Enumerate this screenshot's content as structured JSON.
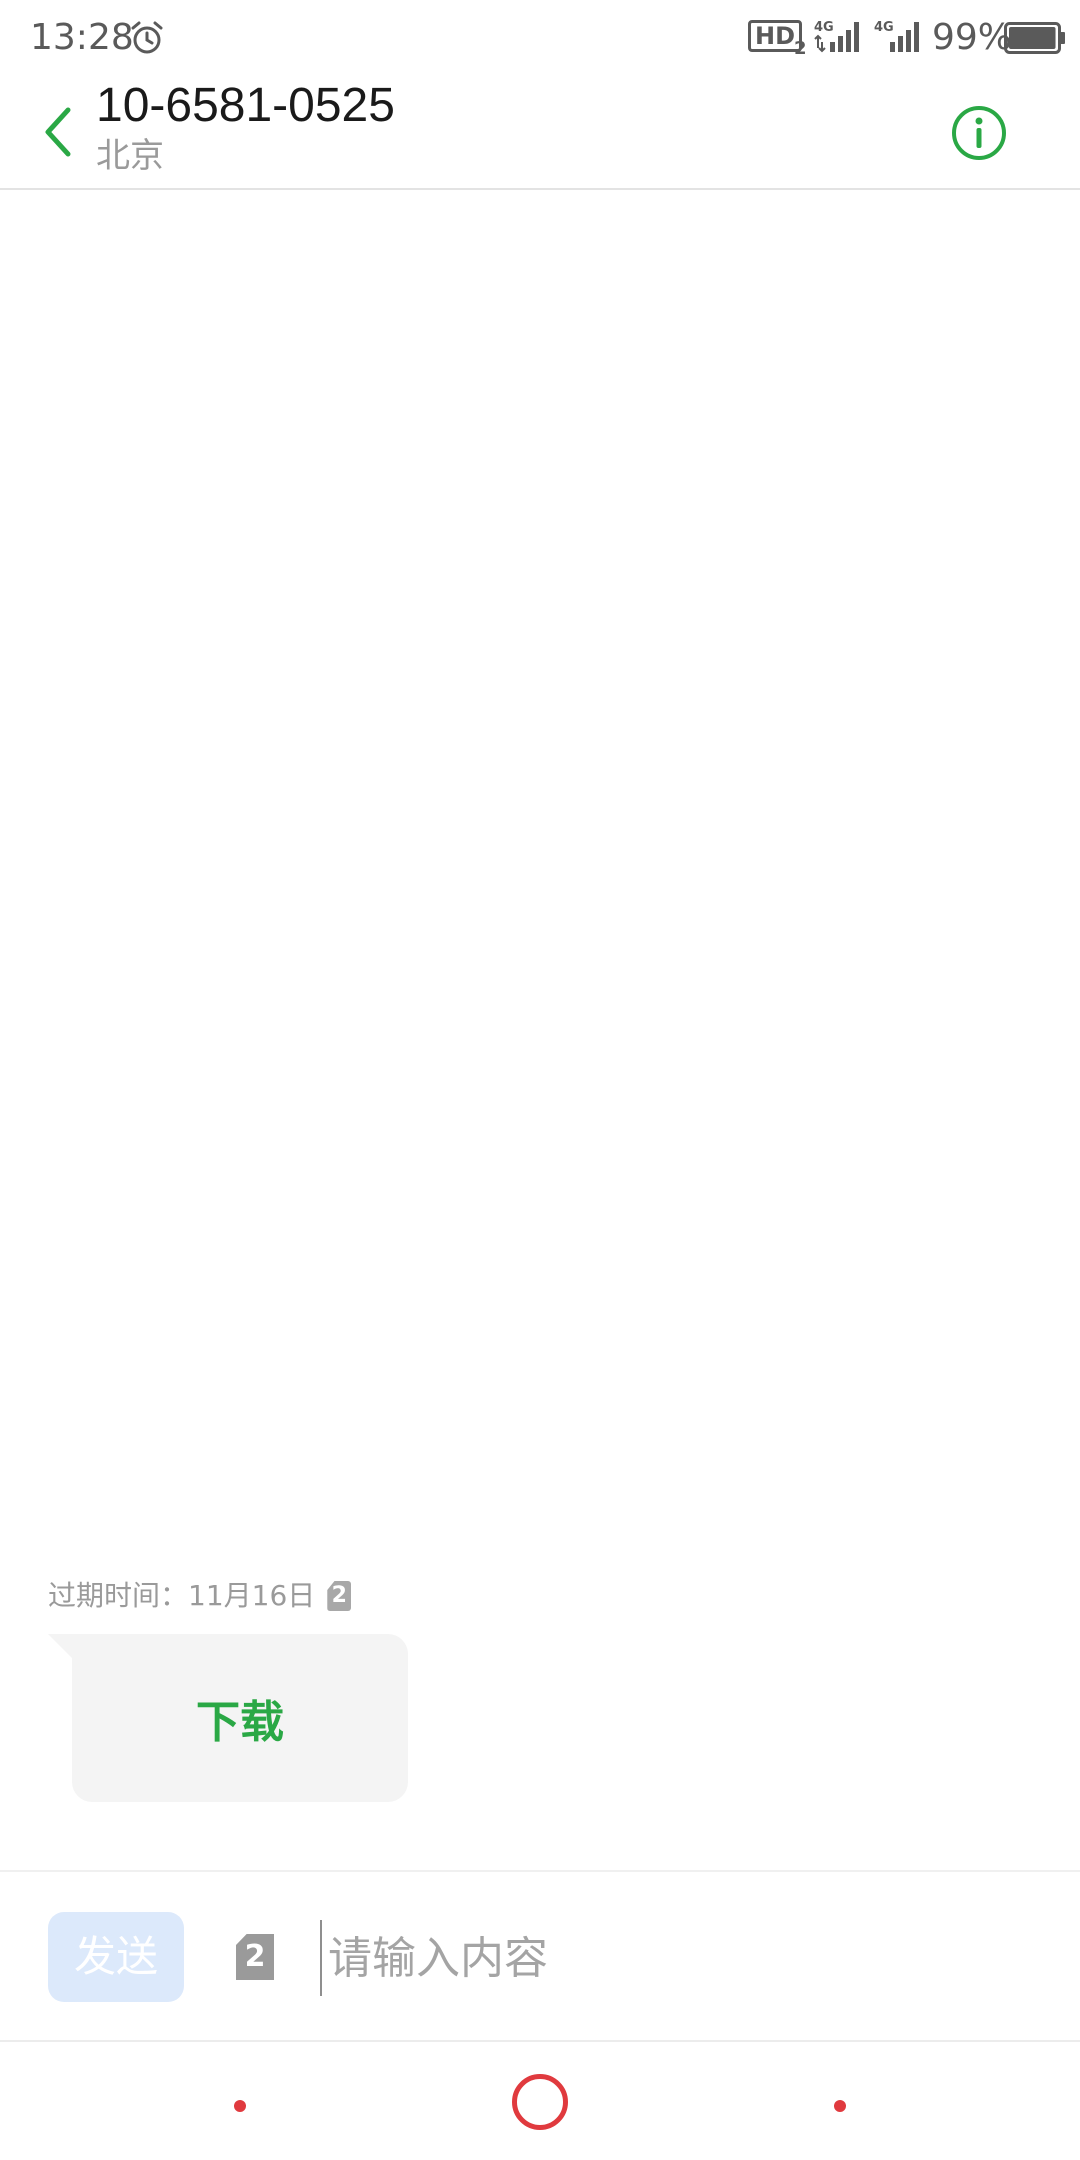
{
  "status_bar": {
    "time": "13:28",
    "hd_label": "HD",
    "hd_sub": "2",
    "network_1": "4G",
    "network_2": "4G",
    "battery_percent": "99%",
    "battery_level": 0.99,
    "icons": [
      "alarm-icon",
      "signal-icon",
      "signal-icon",
      "battery-icon"
    ]
  },
  "header": {
    "contact_number": "10-6581-0525",
    "contact_location": "北京",
    "back_icon": "chevron-left-icon",
    "info_icon": "info-icon"
  },
  "messages": [
    {
      "expire_label": "过期时间：",
      "expire_date": "11月16日",
      "sim_badge": "2",
      "action_label": "下载"
    }
  ],
  "compose": {
    "send_label": "发送",
    "sim_label": "2",
    "input_value": "",
    "input_placeholder": "请输入内容"
  },
  "nav": {
    "buttons": [
      "back",
      "home",
      "recents"
    ]
  },
  "colors": {
    "accent_green": "#2aa845",
    "nav_red": "#e03a3e",
    "send_disabled_bg": "#dce9fb",
    "bubble_bg": "#f4f4f4"
  }
}
